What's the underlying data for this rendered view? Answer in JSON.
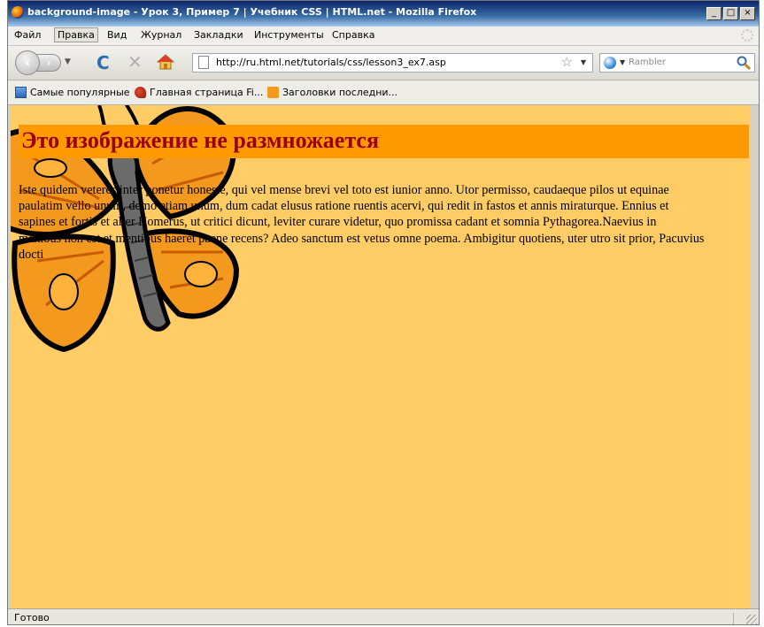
{
  "window": {
    "title": "background-image - Урок 3, Пример 7 | Учебник CSS | HTML.net - Mozilla Firefox",
    "buttons": [
      "_",
      "□",
      "×"
    ]
  },
  "menu": {
    "items": [
      "Файл",
      "Правка",
      "Вид",
      "Журнал",
      "Закладки",
      "Инструменты",
      "Справка"
    ]
  },
  "toolbar": {
    "url": "http://ru.html.net/tutorials/css/lesson3_ex7.asp",
    "search_placeholder": "Rambler"
  },
  "bookmarks": [
    "Самые популярные",
    "Главная страница Fi...",
    "Заголовки последни..."
  ],
  "page": {
    "heading": "Это изображение не размножается",
    "paragraph_lines": [
      "Iste quidem veteres inter ponetur honeste, qui vel mense brevi vel toto est iunior anno. Utor permisso, caudaeque pilos ut equinae",
      "paulatim vello unum, demo etiam unum, dum cadat elusus ratione ruentis acervi, qui redit in fastos et annis miraturque. Ennius et",
      "sapines et fortis et alter Homerus, ut critici dicunt, leviter curare videtur, quo promissa cadant et somnia Pythagorea.Naevius in",
      "manibus non est et mentibus haeret paene recens? Adeo sanctum est vetus omne poema. Ambigitur quotiens, uter utro sit prior, Pacuvius",
      "docti"
    ],
    "background_color": "#ffcc66",
    "heading_background": "#ff9900",
    "heading_color": "#990000"
  },
  "status": {
    "text": "Готово"
  }
}
